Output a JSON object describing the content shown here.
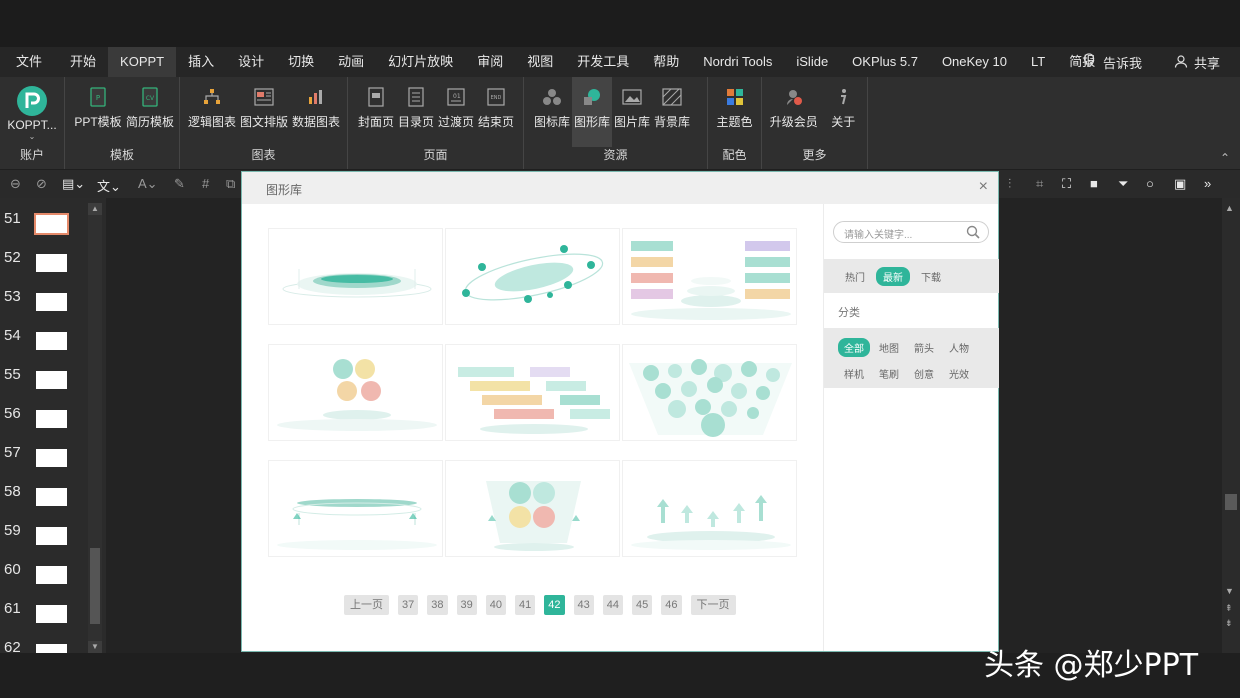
{
  "menubar": {
    "items": [
      "文件",
      "开始",
      "KOPPT",
      "插入",
      "设计",
      "切换",
      "动画",
      "幻灯片放映",
      "审阅",
      "视图",
      "开发工具",
      "帮助",
      "Nordri Tools",
      "iSlide",
      "OKPlus 5.7",
      "OneKey 10",
      "LT",
      "简报"
    ],
    "tell_me": "告诉我",
    "share": "共享"
  },
  "ribbon": {
    "account": {
      "button": "KOPPT...",
      "label": "账户"
    },
    "template": {
      "buttons": [
        "PPT模板",
        "简历模板"
      ],
      "label": "模板"
    },
    "chart": {
      "buttons": [
        "逻辑图表",
        "图文排版",
        "数据图表"
      ],
      "label": "图表"
    },
    "page": {
      "buttons": [
        "封面页",
        "目录页",
        "过渡页",
        "结束页"
      ],
      "label": "页面"
    },
    "resource": {
      "buttons": [
        "图标库",
        "图形库",
        "图片库",
        "背景库"
      ],
      "label": "资源"
    },
    "color": {
      "buttons": [
        "主题色"
      ],
      "label": "配色"
    },
    "more": {
      "buttons": [
        "升级会员",
        "关于"
      ],
      "label": "更多"
    }
  },
  "slides": [
    "51",
    "52",
    "53",
    "54",
    "55",
    "56",
    "57",
    "58",
    "59",
    "60",
    "61",
    "62"
  ],
  "dialog": {
    "title": "图形库",
    "close": "×",
    "search_placeholder": "请输入关键字...",
    "sort_tabs": [
      "热门",
      "最新",
      "下载"
    ],
    "category_title": "分类",
    "categories_row1": [
      "全部",
      "地图",
      "箭头",
      "人物"
    ],
    "categories_row2": [
      "样机",
      "笔刷",
      "创意",
      "光效"
    ],
    "pager": {
      "prev": "上一页",
      "pages": [
        "37",
        "38",
        "39",
        "40",
        "41",
        "42",
        "43",
        "44",
        "45",
        "46"
      ],
      "current": "42",
      "next": "下一页"
    },
    "accent_color": "#2fb59a"
  },
  "watermark": "头条 @郑少PPT"
}
